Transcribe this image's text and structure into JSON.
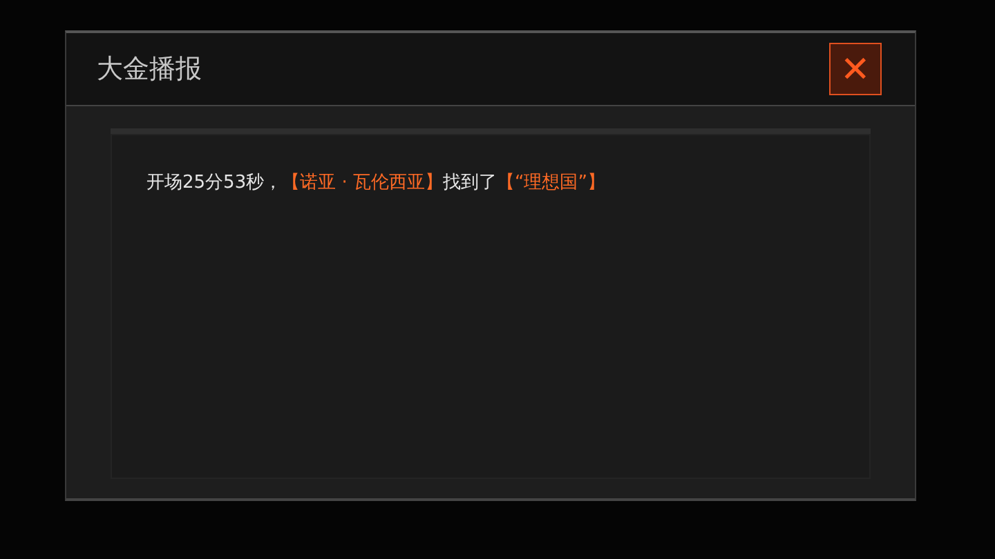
{
  "dialog": {
    "title": "大金播报",
    "close_label": "✕"
  },
  "message": {
    "segments": [
      {
        "text": "开场25分53秒，",
        "highlight": false
      },
      {
        "text": "【诺亚 · 瓦伦西亚】",
        "highlight": true
      },
      {
        "text": "找到了",
        "highlight": false
      },
      {
        "text": "【“理想国”】",
        "highlight": true
      }
    ]
  }
}
